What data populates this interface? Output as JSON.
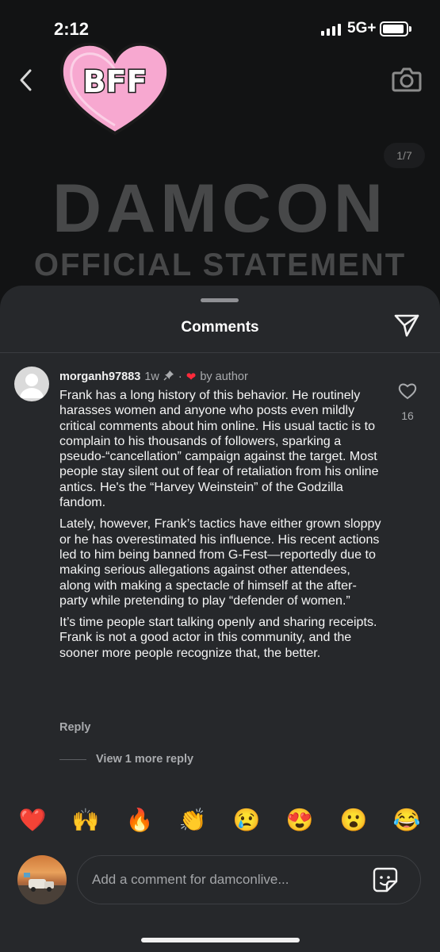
{
  "status_bar": {
    "time": "2:12",
    "network": "5G+"
  },
  "header": {
    "back_icon": "chevron-left-icon",
    "camera_icon": "camera-icon"
  },
  "sticker": {
    "text": "BFF"
  },
  "post": {
    "pager": "1/7",
    "title": "DAMCON",
    "subtitle": "OFFICIAL STATEMENT"
  },
  "comments": {
    "title": "Comments",
    "comment": {
      "username": "morganh97883",
      "age": "1w",
      "liked_by": "by author",
      "like_count": "16",
      "paragraphs": [
        "Frank has a long history of this behavior. He routinely harasses women and anyone who posts even mildly critical comments about him online. His usual tactic is to complain to his thousands of followers, sparking a pseudo-“cancellation” campaign against the target. Most people stay silent out of fear of retaliation from his online antics. He's the “Harvey Weinstein” of the Godzilla fandom.",
        "Lately, however, Frank’s tactics have either grown sloppy or he has overestimated his influence. His recent actions led to him being banned from G-Fest—reportedly due to making serious allegations against other attendees, along with making a spectacle of himself at the after-party while pretending to play “defender of women.”",
        "It’s time people start talking openly and sharing receipts. Frank is not a good actor in this community, and the sooner more people recognize that, the better."
      ],
      "reply_label": "Reply",
      "view_more": "View 1 more reply"
    }
  },
  "emoji_bar": [
    "❤️",
    "🙌",
    "🔥",
    "👏",
    "😢",
    "😍",
    "😮",
    "😂"
  ],
  "composer": {
    "placeholder": "Add a comment for damconlive..."
  },
  "colors": {
    "sheet": "#26282b",
    "heart": "#ff2a3b",
    "sticker_pink": "#f7a8d0"
  }
}
